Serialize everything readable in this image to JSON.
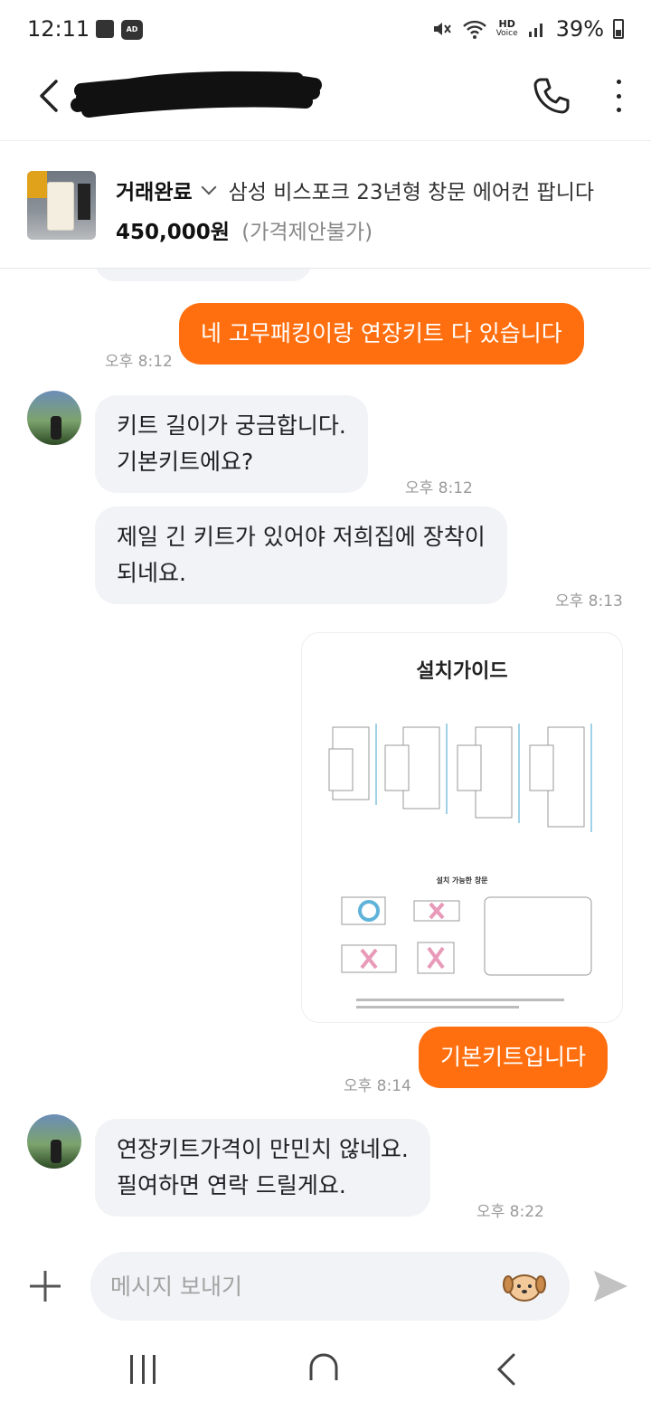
{
  "status_bar": {
    "time": "12:11",
    "ad_icon_label": "AD",
    "hd_label": "HD",
    "voice_label": "Voice",
    "battery": "39%"
  },
  "header": {
    "seller_name": ""
  },
  "product": {
    "status": "거래완료",
    "title": "삼성 비스포크 23년형 창문 에어컨 팝니다",
    "price": "450,000원",
    "price_note": "(가격제안불가)"
  },
  "messages": [
    {
      "sender": "me",
      "text": "네 고무패킹이랑 연장키트 다 있습니다",
      "time": "오후 8:12"
    },
    {
      "sender": "other",
      "lines": [
        "키트 길이가 궁금합니다.",
        "기본키트에요?"
      ],
      "time": "오후 8:12"
    },
    {
      "sender": "other",
      "lines": [
        "제일 긴 키트가 있어야 저희집에 장착이",
        "되네요."
      ],
      "time": "오후 8:13"
    },
    {
      "sender": "me",
      "image_title": "설치가이드",
      "image_subtitle": "설치 가능한 창문",
      "type": "image"
    },
    {
      "sender": "me",
      "text": "기본키트입니다",
      "time": "오후 8:14"
    },
    {
      "sender": "other",
      "lines": [
        "연장키트가격이 만민치 않네요.",
        "필여하면 연락 드릴게요."
      ],
      "time": "오후 8:22"
    }
  ],
  "input": {
    "placeholder": "메시지 보내기"
  },
  "colors": {
    "accent": "#ff6f0f",
    "bubble_other": "#f2f3f6",
    "time_text": "#9a9a9a"
  },
  "icons": {
    "back": "back-arrow-icon",
    "call": "phone-icon",
    "more": "more-vertical-icon",
    "plus": "plus-icon",
    "emoji": "emoji-dog-icon",
    "send": "send-icon"
  }
}
